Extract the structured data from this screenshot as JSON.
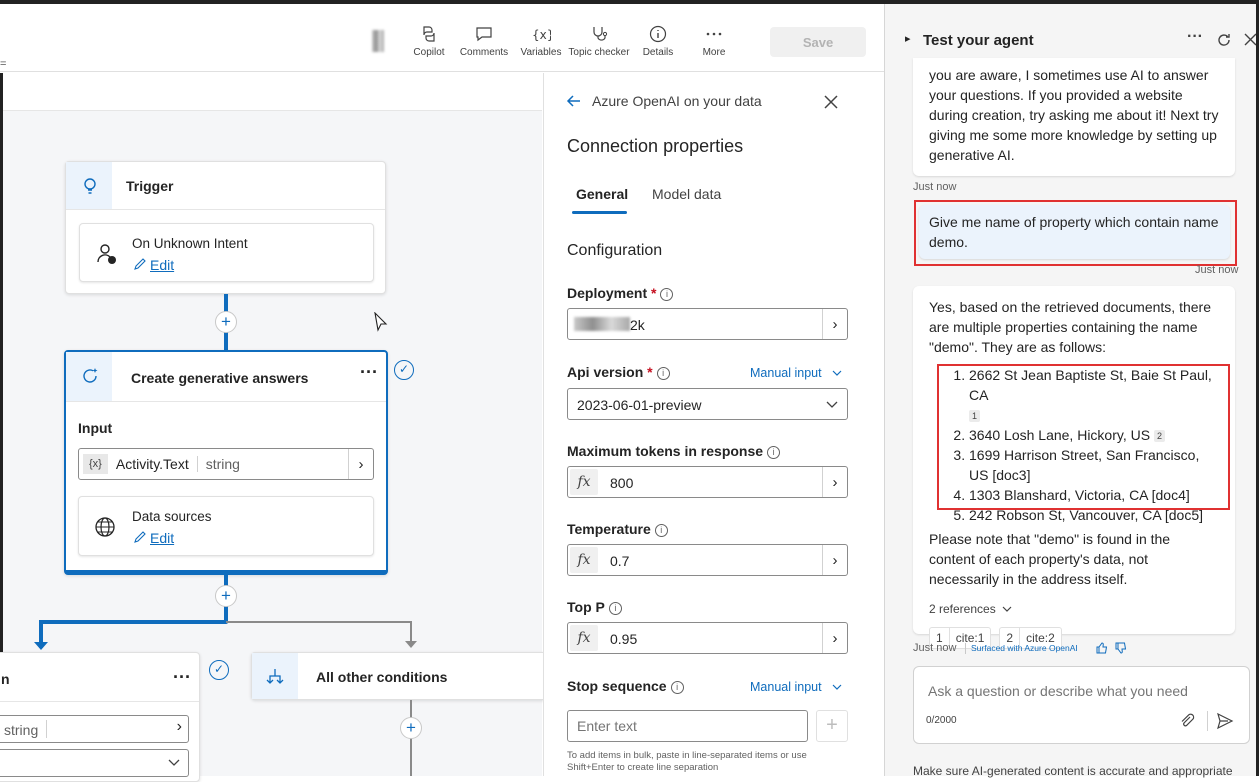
{
  "toolbar": {
    "items": [
      {
        "label": "Copilot",
        "icon": "copilot-icon"
      },
      {
        "label": "Comments",
        "icon": "comment-icon"
      },
      {
        "label": "Variables",
        "icon": "variable-icon"
      },
      {
        "label": "Topic checker",
        "icon": "stethoscope-icon"
      },
      {
        "label": "Details",
        "icon": "info-icon"
      },
      {
        "label": "More",
        "icon": "more-icon"
      }
    ],
    "save_label": "Save"
  },
  "canvas": {
    "trigger": {
      "title": "Trigger",
      "card_title": "On Unknown Intent",
      "edit": "Edit"
    },
    "gen_answers": {
      "title": "Create generative answers",
      "input_label": "Input",
      "input_var": "{x}",
      "input_value": "Activity.Text",
      "input_type": "string",
      "sources_title": "Data sources",
      "edit": "Edit"
    },
    "condition_left": {
      "title": "n",
      "type_text": "string"
    },
    "condition_right": {
      "title": "All other conditions"
    }
  },
  "panel": {
    "back_title": "Azure OpenAI on your data",
    "heading": "Connection properties",
    "tabs": [
      "General",
      "Model data"
    ],
    "section": "Configuration",
    "deployment": {
      "label": "Deployment",
      "value": "2k"
    },
    "api_version": {
      "label": "Api version",
      "mode": "Manual input",
      "value": "2023-06-01-preview"
    },
    "max_tokens": {
      "label": "Maximum tokens in response",
      "value": "800"
    },
    "temperature": {
      "label": "Temperature",
      "value": "0.7"
    },
    "top_p": {
      "label": "Top P",
      "value": "0.95"
    },
    "stop_sequence": {
      "label": "Stop sequence",
      "mode": "Manual input",
      "placeholder": "Enter text",
      "hint": "To add items in bulk, paste in line-separated items or use Shift+Enter to create line separation"
    },
    "fx": "fx"
  },
  "chat": {
    "title": "Test your agent",
    "intro_message": "you are aware, I sometimes use AI to answer your questions. If you provided a website during creation, try asking me about it! Next try giving me some more knowledge by setting up generative AI.",
    "time_1": "Just now",
    "user_message": "Give me name of property which contain name demo.",
    "time_2": "Just now",
    "answer_intro": "Yes, based on the retrieved documents, there are multiple properties containing the name \"demo\". They are as follows:",
    "answer_items": [
      {
        "text": "2662 St Jean Baptiste St, Baie St Paul, CA",
        "cite": "1"
      },
      {
        "text": "3640 Losh Lane, Hickory, US",
        "cite": "2"
      },
      {
        "text": "1699 Harrison Street, San Francisco, US [doc3]",
        "cite": ""
      },
      {
        "text": "1303 Blanshard, Victoria, CA [doc4]",
        "cite": ""
      },
      {
        "text": "242 Robson St, Vancouver, CA [doc5]",
        "cite": ""
      }
    ],
    "answer_outro": "Please note that \"demo\" is found in the content of each property's data, not necessarily in the address itself.",
    "references_label": "2 references",
    "refs": [
      {
        "num": "1",
        "label": "cite:1"
      },
      {
        "num": "2",
        "label": "cite:2"
      }
    ],
    "time_3": "Just now",
    "surfaced_label": "Surfaced with Azure OpenAI",
    "input_placeholder": "Ask a question or describe what you need",
    "char_count": "0/2000",
    "disclaimer": "Make sure AI-generated content is accurate and appropriate"
  }
}
